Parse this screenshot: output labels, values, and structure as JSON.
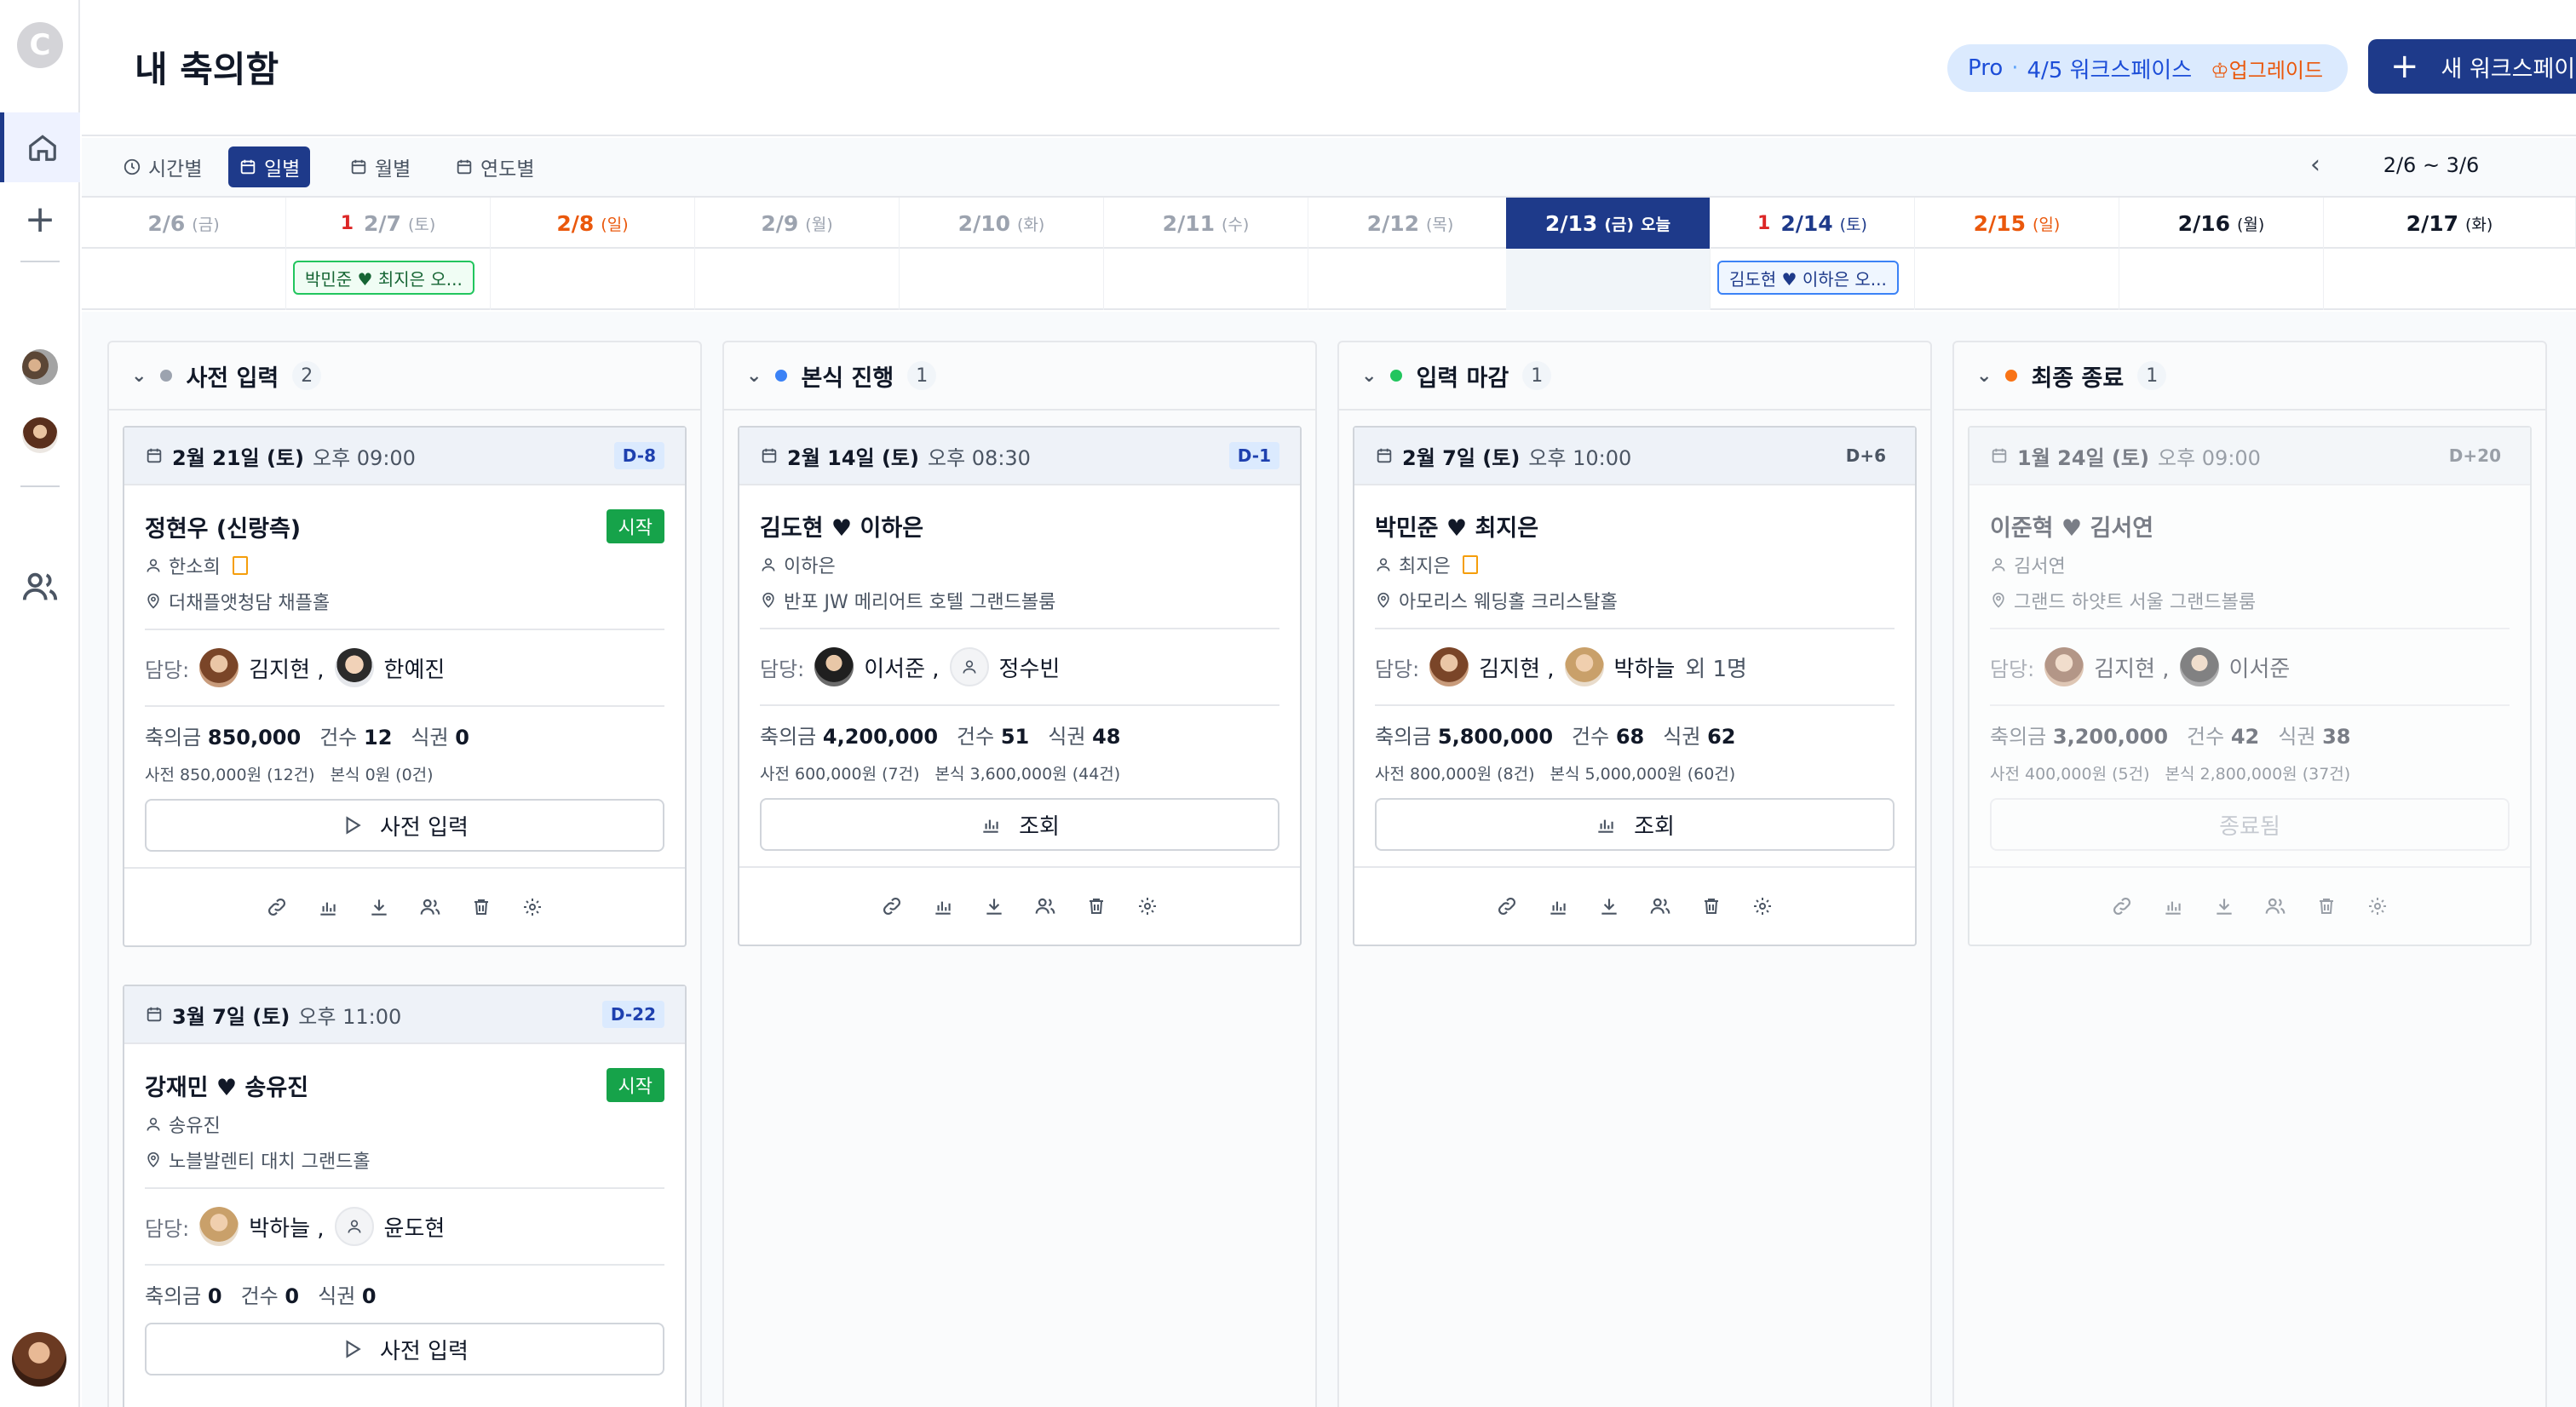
{
  "header": {
    "title": "내 축의함",
    "plan_name": "Pro",
    "plan_dot": "·",
    "plan_usage": "4/5 워크스페이스",
    "upgrade_label": "♔업그레이드",
    "new_workspace_label": "새 워크스페이스"
  },
  "views": {
    "tabs": [
      "시간별",
      "일별",
      "월별",
      "연도별"
    ],
    "active": "일별",
    "range": "2/6 ~ 3/6"
  },
  "dates": [
    {
      "d": "2/6",
      "w": "(금)",
      "style": "muted"
    },
    {
      "d": "2/7",
      "w": "(토)",
      "style": "muted",
      "count": "1"
    },
    {
      "d": "2/8",
      "w": "(일)",
      "style": "red"
    },
    {
      "d": "2/9",
      "w": "(월)",
      "style": "muted"
    },
    {
      "d": "2/10",
      "w": "(화)",
      "style": "muted"
    },
    {
      "d": "2/11",
      "w": "(수)",
      "style": "muted"
    },
    {
      "d": "2/12",
      "w": "(목)",
      "style": "muted"
    },
    {
      "d": "2/13",
      "w": "(금)",
      "style": "today",
      "today": "오늘"
    },
    {
      "d": "2/14",
      "w": "(토)",
      "style": "dark-blue",
      "count": "1"
    },
    {
      "d": "2/15",
      "w": "(일)",
      "style": "red"
    },
    {
      "d": "2/16",
      "w": "(월)",
      "style": "dark"
    },
    {
      "d": "2/17",
      "w": "(화)",
      "style": "dark"
    }
  ],
  "strip_events": [
    {
      "label": "박민준 ♥ 최지은 오...",
      "color": "green"
    },
    {
      "label": "김도현 ♥ 이하은 오...",
      "color": "blue"
    }
  ],
  "labels": {
    "staff": "담당:",
    "gift": "축의금",
    "count": "건수",
    "meal": "식권",
    "start_badge": "시작"
  },
  "columns": [
    {
      "title": "사전 입력",
      "count": "2",
      "dot": "#9ca3af"
    },
    {
      "title": "본식 진행",
      "count": "1",
      "dot": "#3b82f6"
    },
    {
      "title": "입력 마감",
      "count": "1",
      "dot": "#22c55e"
    },
    {
      "title": "최종 종료",
      "count": "1",
      "dot": "#f97316"
    }
  ],
  "cards": {
    "c1": {
      "date": "2월 21일 (토)",
      "time": "오후 09:00",
      "dday": "D-8",
      "names": "정현우 (신랑측)",
      "host": "한소희",
      "venue": "더채플앳청담 채플홀",
      "staff1": "김지현 ,",
      "staff2": "한예진",
      "gift": "850,000",
      "count": "12",
      "meal": "0",
      "sub1": "사전 850,000원 (12건)",
      "sub2": "본식 0원 (0건)",
      "action": "사전 입력"
    },
    "c2": {
      "date": "3월 7일 (토)",
      "time": "오후 11:00",
      "dday": "D-22",
      "names": "강재민 ♥ 송유진",
      "host": "송유진",
      "venue": "노블발렌티 대치 그랜드홀",
      "staff1": "박하늘 ,",
      "staff2": "윤도현",
      "gift": "0",
      "count": "0",
      "meal": "0",
      "action": "사전 입력"
    },
    "c3": {
      "date": "2월 14일 (토)",
      "time": "오후 08:30",
      "dday": "D-1",
      "names": "김도현 ♥ 이하은",
      "host": "이하은",
      "venue": "반포 JW 메리어트 호텔 그랜드볼룸",
      "staff1": "이서준 ,",
      "staff2": "정수빈",
      "gift": "4,200,000",
      "count": "51",
      "meal": "48",
      "sub1": "사전 600,000원 (7건)",
      "sub2": "본식 3,600,000원 (44건)",
      "action": "조회"
    },
    "c4": {
      "date": "2월 7일 (토)",
      "time": "오후 10:00",
      "dday": "D+6",
      "names": "박민준 ♥ 최지은",
      "host": "최지은",
      "venue": "아모리스 웨딩홀 크리스탈홀",
      "staff1": "김지현 ,",
      "staff2": "박하늘",
      "more": "외 1명",
      "gift": "5,800,000",
      "count": "68",
      "meal": "62",
      "sub1": "사전 800,000원 (8건)",
      "sub2": "본식 5,000,000원 (60건)",
      "action": "조회"
    },
    "c5": {
      "date": "1월 24일 (토)",
      "time": "오후 09:00",
      "dday": "D+20",
      "names": "이준혁 ♥ 김서연",
      "host": "김서연",
      "venue": "그랜드 하얏트 서울 그랜드볼룸",
      "staff1": "김지현 ,",
      "staff2": "이서준",
      "gift": "3,200,000",
      "count": "42",
      "meal": "38",
      "sub1": "사전 400,000원 (5건)",
      "sub2": "본식 2,800,000원 (37건)",
      "action": "종료됨"
    }
  }
}
